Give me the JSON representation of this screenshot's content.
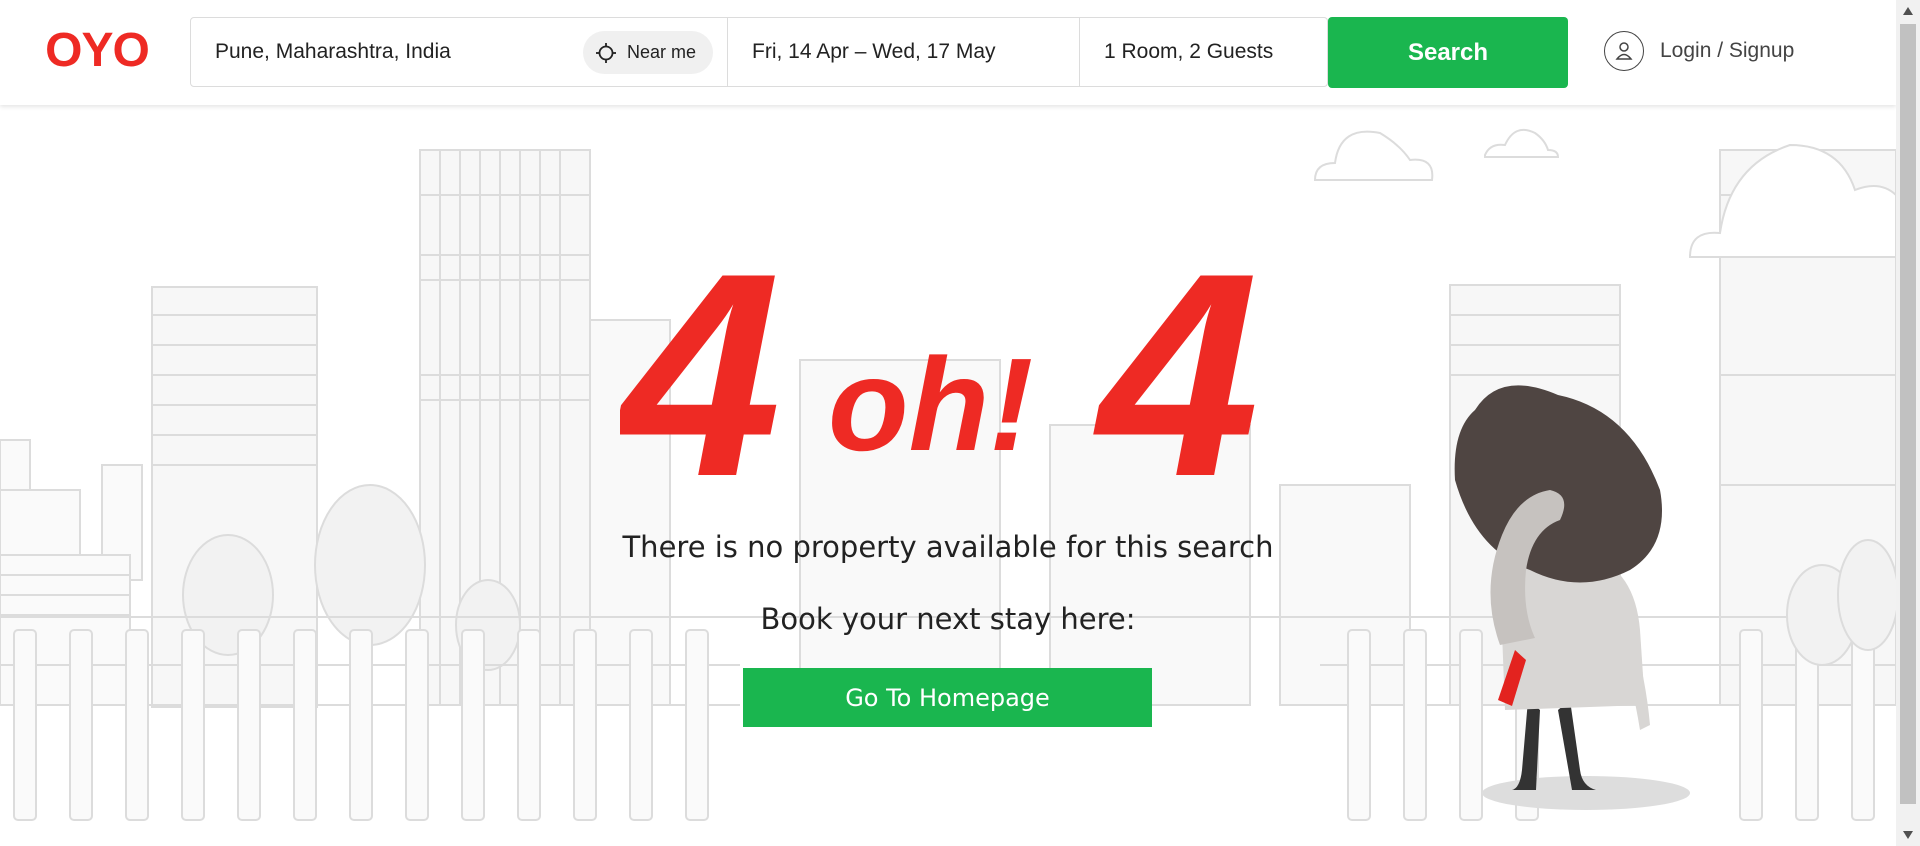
{
  "brand": {
    "logo_text": "OYO",
    "accent_red": "#ee2a24",
    "accent_green": "#1ab64f"
  },
  "search": {
    "location": "Pune, Maharashtra, India",
    "near_me_label": "Near me",
    "near_me_icon": "crosshair-icon",
    "dates": "Fri, 14 Apr – Wed, 17 May",
    "guests": "1 Room, 2 Guests",
    "button_label": "Search"
  },
  "account": {
    "login_label": "Login / Signup",
    "icon": "user-icon"
  },
  "error": {
    "digit_left": "4",
    "middle": "oh!",
    "digit_right": "4",
    "message": "There is no property available for this search",
    "prompt": "Book your next stay here:",
    "home_button_label": "Go To Homepage"
  }
}
